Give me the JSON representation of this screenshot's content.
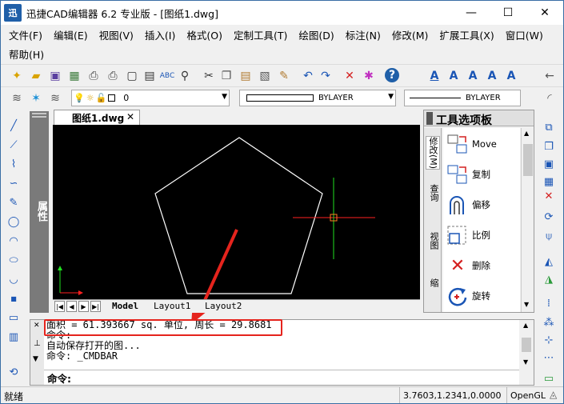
{
  "window": {
    "app_icon_text": "迅",
    "title": "迅捷CAD编辑器 6.2 专业版  - [图纸1.dwg]",
    "minimize": "—",
    "maximize": "☐",
    "close": "✕"
  },
  "menu": {
    "row1": [
      "文件(F)",
      "编辑(E)",
      "视图(V)",
      "插入(I)",
      "格式(O)",
      "定制工具(T)",
      "绘图(D)",
      "标注(N)",
      "修改(M)",
      "扩展工具(X)",
      "窗口(W)"
    ],
    "row2": [
      "帮助(H)"
    ]
  },
  "toolbar2": {
    "layer_value": "0",
    "linetype_value": "BYLAYER",
    "lineweight_value": "BYLAYER"
  },
  "properties_panel": {
    "label": "属性"
  },
  "document_tab": {
    "title": "图纸1.dwg",
    "close": "✕"
  },
  "layout_tabs": [
    "Model",
    "Layout1",
    "Layout2"
  ],
  "tool_palette": {
    "title": "工具选项板",
    "tabs": [
      "修改(M)",
      "查询",
      "视图",
      "缩"
    ],
    "items": [
      {
        "label": "Move",
        "icon": "move-icon"
      },
      {
        "label": "复制",
        "icon": "copy-icon"
      },
      {
        "label": "偏移",
        "icon": "offset-icon"
      },
      {
        "label": "比例",
        "icon": "scale-icon"
      },
      {
        "label": "删除",
        "icon": "delete-icon"
      },
      {
        "label": "旋转",
        "icon": "rotate-icon"
      }
    ]
  },
  "command": {
    "history": [
      "面积 = 61.393667 sq. 单位, 周长 = 29.8681",
      "命令:",
      "自动保存打开的图...",
      "命令:  _CMDBAR"
    ],
    "prompt": "命令:"
  },
  "status": {
    "left": "就绪",
    "coordinates": "3.7603,1.2341,0.0000",
    "renderer": "OpenGL"
  },
  "colors": {
    "highlight": "#e5241d",
    "canvas": "#000000",
    "accent": "#1f5fa8"
  }
}
